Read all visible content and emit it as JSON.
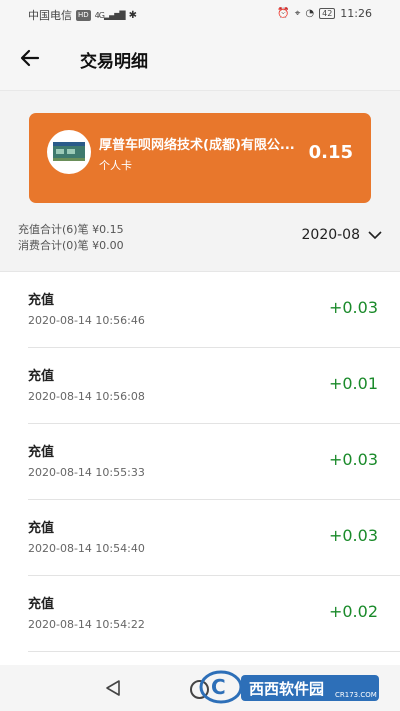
{
  "status_bar": {
    "carrier": "中国电信",
    "hd": "HD",
    "network": "4G",
    "battery": "42",
    "time": "11:26"
  },
  "header": {
    "title": "交易明细"
  },
  "card": {
    "name": "厚普车呗网络技术(成都)有限公...",
    "type": "个人卡",
    "balance": "0.15",
    "color": "#e8772c"
  },
  "summary": {
    "recharge_total": "充值合计(6)笔 ¥0.15",
    "consume_total": "消费合计(0)笔 ¥0.00",
    "month": "2020-08"
  },
  "transactions": [
    {
      "type": "充值",
      "time": "2020-08-14 10:56:46",
      "amount": "+0.03"
    },
    {
      "type": "充值",
      "time": "2020-08-14 10:56:08",
      "amount": "+0.01"
    },
    {
      "type": "充值",
      "time": "2020-08-14 10:55:33",
      "amount": "+0.03"
    },
    {
      "type": "充值",
      "time": "2020-08-14 10:54:40",
      "amount": "+0.03"
    },
    {
      "type": "充值",
      "time": "2020-08-14 10:54:22",
      "amount": "+0.02"
    }
  ],
  "colors": {
    "positive": "#1a8a2a",
    "accent": "#e8772c"
  },
  "watermark": {
    "brand": "西西软件园",
    "domain": "CR173.COM"
  }
}
